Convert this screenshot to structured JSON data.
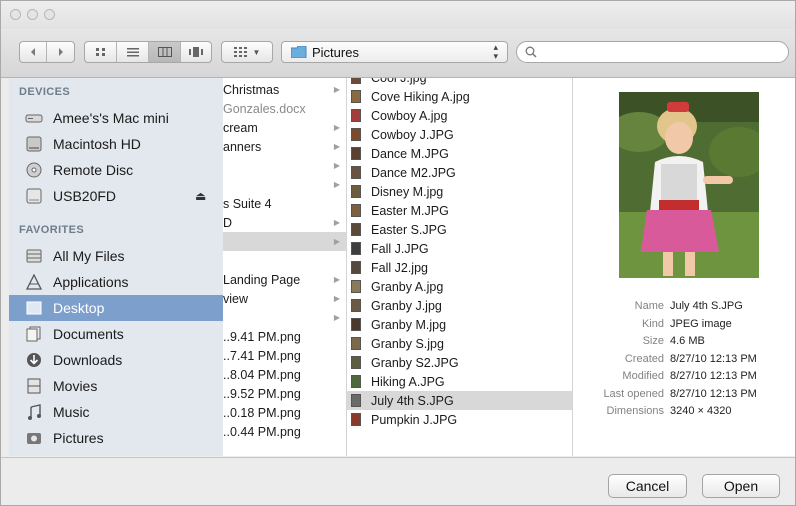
{
  "toolbar": {
    "back_icon": "chevron-left-icon",
    "forward_icon": "chevron-right-icon",
    "view_icons": [
      "icon-view-icon",
      "list-view-icon",
      "column-view-icon",
      "cover-flow-icon"
    ],
    "arrange_icon": "grid-arrange-icon",
    "location": "Pictures",
    "search_placeholder": ""
  },
  "sidebar": {
    "devices_header": "DEVICES",
    "devices": [
      {
        "label": "Amee's's Mac mini",
        "icon": "computer-icon"
      },
      {
        "label": "Macintosh HD",
        "icon": "hard-drive-icon"
      },
      {
        "label": "Remote Disc",
        "icon": "disc-icon"
      },
      {
        "label": "USB20FD",
        "icon": "usb-drive-icon",
        "eject": "⏏"
      }
    ],
    "favorites_header": "FAVORITES",
    "favorites": [
      {
        "label": "All My Files",
        "icon": "all-files-icon"
      },
      {
        "label": "Applications",
        "icon": "applications-icon"
      },
      {
        "label": "Desktop",
        "icon": "desktop-icon",
        "selected": true
      },
      {
        "label": "Documents",
        "icon": "documents-icon"
      },
      {
        "label": "Downloads",
        "icon": "downloads-icon"
      },
      {
        "label": "Movies",
        "icon": "movies-icon"
      },
      {
        "label": "Music",
        "icon": "music-icon"
      },
      {
        "label": "Pictures",
        "icon": "pictures-icon"
      }
    ]
  },
  "column1": {
    "items": [
      {
        "label": "Christmas",
        "arrow": true
      },
      {
        "label": "Gonzales.docx",
        "arrow": false,
        "muted": true
      },
      {
        "label": "cream",
        "arrow": true
      },
      {
        "label": "anners",
        "arrow": true
      },
      {
        "label": "",
        "arrow": true
      },
      {
        "label": "",
        "arrow": true
      },
      {
        "label": "s Suite 4",
        "arrow": false
      },
      {
        "label": "D",
        "arrow": true
      },
      {
        "label": "",
        "arrow": true,
        "selected": true
      },
      {
        "label": "",
        "arrow": false
      },
      {
        "label": "Landing Page",
        "arrow": true
      },
      {
        "label": "view",
        "arrow": true
      },
      {
        "label": "",
        "arrow": true
      },
      {
        "label": "..9.41 PM.png",
        "arrow": false
      },
      {
        "label": "..7.41 PM.png",
        "arrow": false
      },
      {
        "label": "..8.04 PM.png",
        "arrow": false
      },
      {
        "label": "..9.52 PM.png",
        "arrow": false
      },
      {
        "label": "..0.18 PM.png",
        "arrow": false
      },
      {
        "label": "..0.44 PM.png",
        "arrow": false
      }
    ]
  },
  "column2": {
    "items": [
      {
        "label": "Cool J.jpg"
      },
      {
        "label": "Cove Hiking A.jpg"
      },
      {
        "label": "Cowboy A.jpg"
      },
      {
        "label": "Cowboy J.JPG"
      },
      {
        "label": "Dance M.JPG"
      },
      {
        "label": "Dance M2.JPG"
      },
      {
        "label": "Disney M.jpg"
      },
      {
        "label": "Easter M.JPG"
      },
      {
        "label": "Easter S.JPG"
      },
      {
        "label": "Fall J.JPG"
      },
      {
        "label": "Fall J2.jpg"
      },
      {
        "label": "Granby A.jpg"
      },
      {
        "label": "Granby J.jpg"
      },
      {
        "label": "Granby M.jpg"
      },
      {
        "label": "Granby S.jpg"
      },
      {
        "label": "Granby S2.JPG"
      },
      {
        "label": "Hiking A.JPG"
      },
      {
        "label": "July 4th S.JPG",
        "selected": true
      },
      {
        "label": "Pumpkin J.JPG"
      }
    ]
  },
  "preview": {
    "image_alt": "photo-preview",
    "meta": [
      {
        "key": "Name",
        "value": "July 4th S.JPG"
      },
      {
        "key": "Kind",
        "value": "JPEG image"
      },
      {
        "key": "Size",
        "value": "4.6 MB"
      },
      {
        "key": "Created",
        "value": "8/27/10 12:13 PM"
      },
      {
        "key": "Modified",
        "value": "8/27/10 12:13 PM"
      },
      {
        "key": "Last opened",
        "value": "8/27/10 12:13 PM"
      },
      {
        "key": "Dimensions",
        "value": "3240 × 4320"
      }
    ]
  },
  "buttons": {
    "cancel": "Cancel",
    "open": "Open"
  },
  "colors": {
    "selection": "#7c9fcb",
    "file_selection": "#d8d8d8",
    "sidebar_bg": "#e3e8ee"
  }
}
